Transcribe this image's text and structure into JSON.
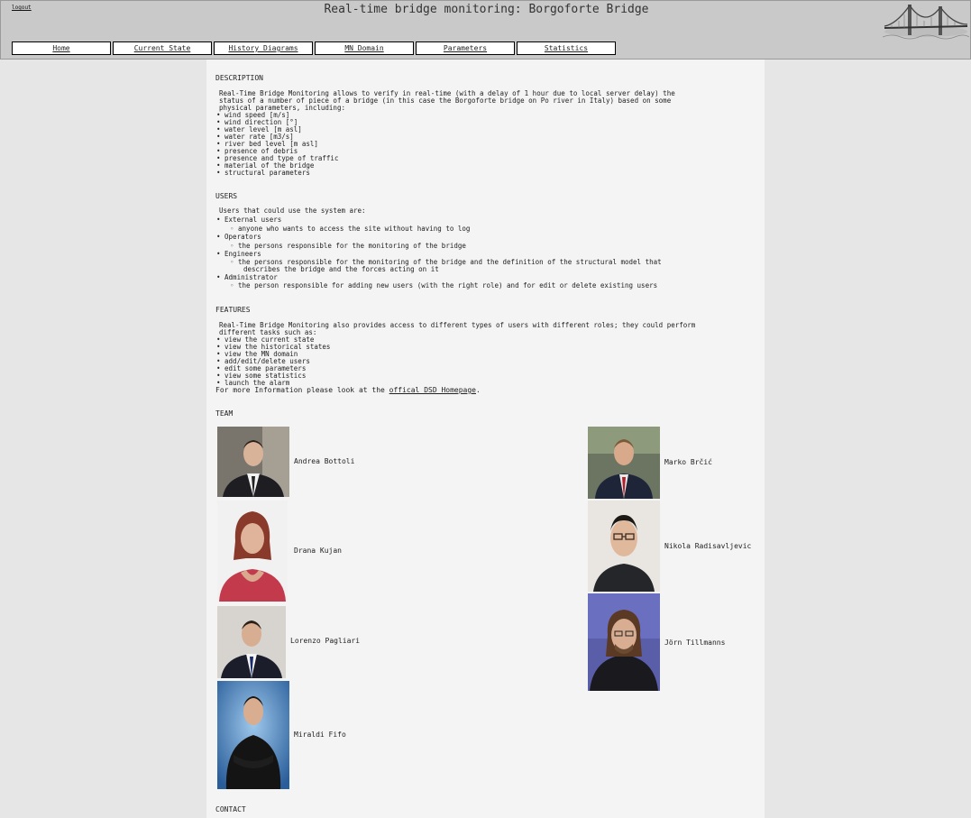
{
  "header": {
    "logout": "logout",
    "title": "Real-time bridge monitoring: Borgoforte Bridge",
    "nav": [
      "Home",
      "Current State",
      "History Diagrams",
      "MN Domain",
      "Parameters",
      "Statistics"
    ]
  },
  "description": {
    "heading": "DESCRIPTION",
    "intro": [
      "Real-Time Bridge Monitoring allows to verify in real-time (with a delay of 1 hour due to local server delay) the",
      "status of a number of piece of a bridge (in this case the Borgoforte bridge on Po river in Italy) based on some",
      "physical parameters, including:"
    ],
    "items": [
      "wind speed [m/s]",
      "wind direction [°]",
      "water level [m asl]",
      "water rate [m3/s]",
      "river bed level [m asl]",
      "presence of debris",
      "presence and type of traffic",
      "material of the bridge",
      "structural parameters"
    ]
  },
  "users": {
    "heading": "USERS",
    "intro": "Users that could use the system are:",
    "groups": [
      {
        "name": "External users",
        "desc": [
          "anyone who wants to access the site without having to log"
        ]
      },
      {
        "name": "Operators",
        "desc": [
          "the persons responsible for the monitoring of the bridge"
        ]
      },
      {
        "name": "Engineers",
        "desc": [
          "the persons responsible for the monitoring of the bridge and the definition of the structural model that",
          "describes the bridge and the forces acting on it"
        ]
      },
      {
        "name": "Administrator",
        "desc": [
          "the person responsible for adding new users (with the right role) and for edit or delete existing users"
        ]
      }
    ]
  },
  "features": {
    "heading": "FEATURES",
    "intro": [
      "Real-Time Bridge Monitoring also provides access to different types of users with different roles; they could perform",
      "different tasks such as:"
    ],
    "items": [
      "view the current state",
      "view the historical states",
      "view the MN domain",
      "add/edit/delete users",
      "edit some parameters",
      "view some statistics",
      "launch the alarm"
    ],
    "more_prefix": "For more Information please look at the ",
    "more_link": "offical DSD Homepage",
    "more_suffix": "."
  },
  "team": {
    "heading": "TEAM",
    "members": [
      "Andrea Bottoli",
      "Marko Brčić",
      "Drana Kujan",
      "Nikola Radisavljevic",
      "Lorenzo Pagliari",
      "Jörn Tillmanns",
      "Miraldi Fifo"
    ]
  },
  "contact": {
    "heading": "CONTACT"
  },
  "colors": {
    "header_bg": "#c9c9c9",
    "page_bg": "#e6e6e6",
    "content_bg": "#f4f4f4",
    "nav_bg": "#ffffff"
  }
}
